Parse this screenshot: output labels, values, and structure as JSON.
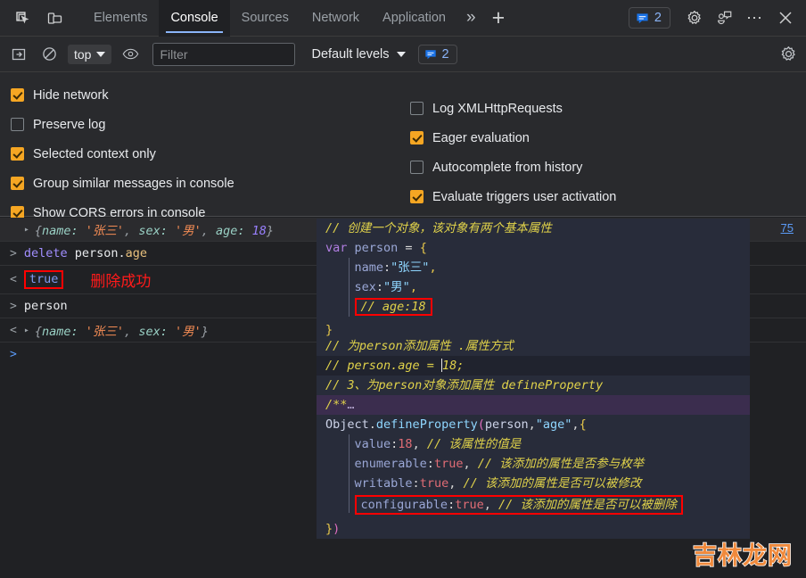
{
  "tabbar": {
    "inspect_icon": "inspect-element-icon",
    "device_icon": "device-toolbar-icon",
    "tabs": [
      {
        "label": "Elements",
        "active": false
      },
      {
        "label": "Console",
        "active": true
      },
      {
        "label": "Sources",
        "active": false
      },
      {
        "label": "Network",
        "active": false
      },
      {
        "label": "Application",
        "active": false
      }
    ],
    "more_tabs": "»",
    "add_tab": "+",
    "message_count": "2",
    "settings_icon": "gear-icon",
    "feedback_icon": "feedback-icon",
    "more_icon": "⋯",
    "close_icon": "×"
  },
  "console_toolbar": {
    "sidebar_icon": "show-console-sidebar-icon",
    "clear_icon": "clear-console-icon",
    "context": "top",
    "live_expression_icon": "create-live-expression-icon",
    "filter_placeholder": "Filter",
    "filter_value": "",
    "levels_label": "Default levels",
    "message_count": "2",
    "settings_icon": "console-settings-gear-icon"
  },
  "settings": {
    "left": [
      {
        "label": "Hide network",
        "checked": true
      },
      {
        "label": "Preserve log",
        "checked": false
      },
      {
        "label": "Selected context only",
        "checked": true
      },
      {
        "label": "Group similar messages in console",
        "checked": true
      },
      {
        "label": "Show CORS errors in console",
        "checked": true
      }
    ],
    "right": [
      {
        "label": "Log XMLHttpRequests",
        "checked": false
      },
      {
        "label": "Eager evaluation",
        "checked": true
      },
      {
        "label": "Autocomplete from history",
        "checked": false
      },
      {
        "label": "Evaluate triggers user activation",
        "checked": true
      }
    ]
  },
  "console_log": {
    "source_link": "75",
    "rows": [
      {
        "type": "result",
        "text": "{name: '张三', sex: '男', age: 18}",
        "parts": [
          {
            "t": "{",
            "c": "brace"
          },
          {
            "t": "name: ",
            "c": "key"
          },
          {
            "t": "'张三'",
            "c": "str"
          },
          {
            "t": ", ",
            "c": "brace"
          },
          {
            "t": "sex: ",
            "c": "key"
          },
          {
            "t": "'男'",
            "c": "str"
          },
          {
            "t": ", ",
            "c": "brace"
          },
          {
            "t": "age: ",
            "c": "key"
          },
          {
            "t": "18",
            "c": "num"
          },
          {
            "t": "}",
            "c": "brace"
          }
        ]
      },
      {
        "type": "input",
        "text": "delete person.age"
      },
      {
        "type": "result_bool",
        "text": "true",
        "annotation": "删除成功"
      },
      {
        "type": "input",
        "text": "person"
      },
      {
        "type": "result",
        "text": "{name: '张三', sex: '男'}",
        "parts": [
          {
            "t": "{",
            "c": "brace"
          },
          {
            "t": "name: ",
            "c": "key"
          },
          {
            "t": "'张三'",
            "c": "str"
          },
          {
            "t": ", ",
            "c": "brace"
          },
          {
            "t": "sex: ",
            "c": "key"
          },
          {
            "t": "'男'",
            "c": "str"
          },
          {
            "t": "}",
            "c": "brace"
          }
        ]
      }
    ],
    "prompt": ">"
  },
  "code_panel": {
    "lines": [
      "// 创建一个对象，该对象有两个基本属性",
      "var person = {",
      "    name:\"张三\",",
      "    sex:\"男\",",
      "    // age:18",
      "}",
      "// 为person添加属性 .属性方式",
      "// person.age = 18;",
      "// 3、为person对象添加属性 defineProperty",
      "/**…",
      "Object.defineProperty(person,\"age\",{",
      "    value:18, // 该属性的值是",
      "    enumerable:true, // 该添加的属性是否参与枚举",
      "    writable:true, // 该添加的属性是否可以被修改",
      "    configurable:true, // 该添加的属性是否可以被删除",
      "})"
    ]
  },
  "watermark": {
    "text": "吉林龙网"
  }
}
